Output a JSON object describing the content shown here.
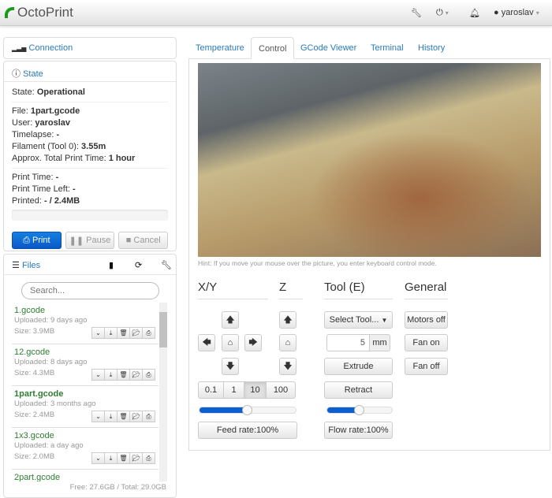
{
  "navbar": {
    "brand": "OctoPrint",
    "user": "yaroslav",
    "icons": [
      "wrench-icon",
      "power-icon",
      "bell-icon",
      "user-icon"
    ]
  },
  "connection": {
    "title": "Connection"
  },
  "state": {
    "title": "State",
    "state_label": "State:",
    "state_value": "Operational",
    "file_label": "File:",
    "file_value": "1part.gcode",
    "user_label": "User:",
    "user_value": "yaroslav",
    "timelapse_label": "Timelapse:",
    "timelapse_value": "-",
    "filament_label": "Filament (Tool 0):",
    "filament_value": "3.55m",
    "approx_label": "Approx. Total Print Time:",
    "approx_value": "1 hour",
    "print_time_label": "Print Time:",
    "print_time_value": "-",
    "time_left_label": "Print Time Left:",
    "time_left_value": "-",
    "printed_label": "Printed:",
    "printed_value": "- / 2.4MB",
    "progress": 0,
    "print": "Print",
    "pause": "Pause",
    "cancel": "Cancel"
  },
  "files": {
    "title": "Files",
    "search_placeholder": "Search...",
    "items": [
      {
        "name": "1.gcode",
        "uploaded": "Uploaded: 9 days ago",
        "size": "Size: 3.9MB"
      },
      {
        "name": "12.gcode",
        "uploaded": "Uploaded: 8 days ago",
        "size": "Size: 4.3MB"
      },
      {
        "name": "1part.gcode",
        "uploaded": "Uploaded: 3 months ago",
        "size": "Size: 2.4MB"
      },
      {
        "name": "1x3.gcode",
        "uploaded": "Uploaded: a day ago",
        "size": "Size: 2.0MB"
      },
      {
        "name": "2part.gcode"
      }
    ],
    "footer": "Free: 27.6GB / Total: 29.0GB"
  },
  "tabs": [
    "Temperature",
    "Control",
    "GCode Viewer",
    "Terminal",
    "History"
  ],
  "control": {
    "hint": "Hint: If you move your mouse over the picture, you enter keyboard control mode.",
    "xy": "X/Y",
    "z": "Z",
    "tool": "Tool (E)",
    "general": "General",
    "steps": [
      "0.1",
      "1",
      "10",
      "100"
    ],
    "active_step": "10",
    "select_tool": "Select Tool...",
    "extrude_amount": "5",
    "unit": "mm",
    "extrude": "Extrude",
    "retract": "Retract",
    "motors_off": "Motors off",
    "fan_on": "Fan on",
    "fan_off": "Fan off",
    "feed_rate": "Feed rate:100%",
    "flow_rate": "Flow rate:100%",
    "feed_slider": 0.5,
    "flow_slider": 0.5
  }
}
